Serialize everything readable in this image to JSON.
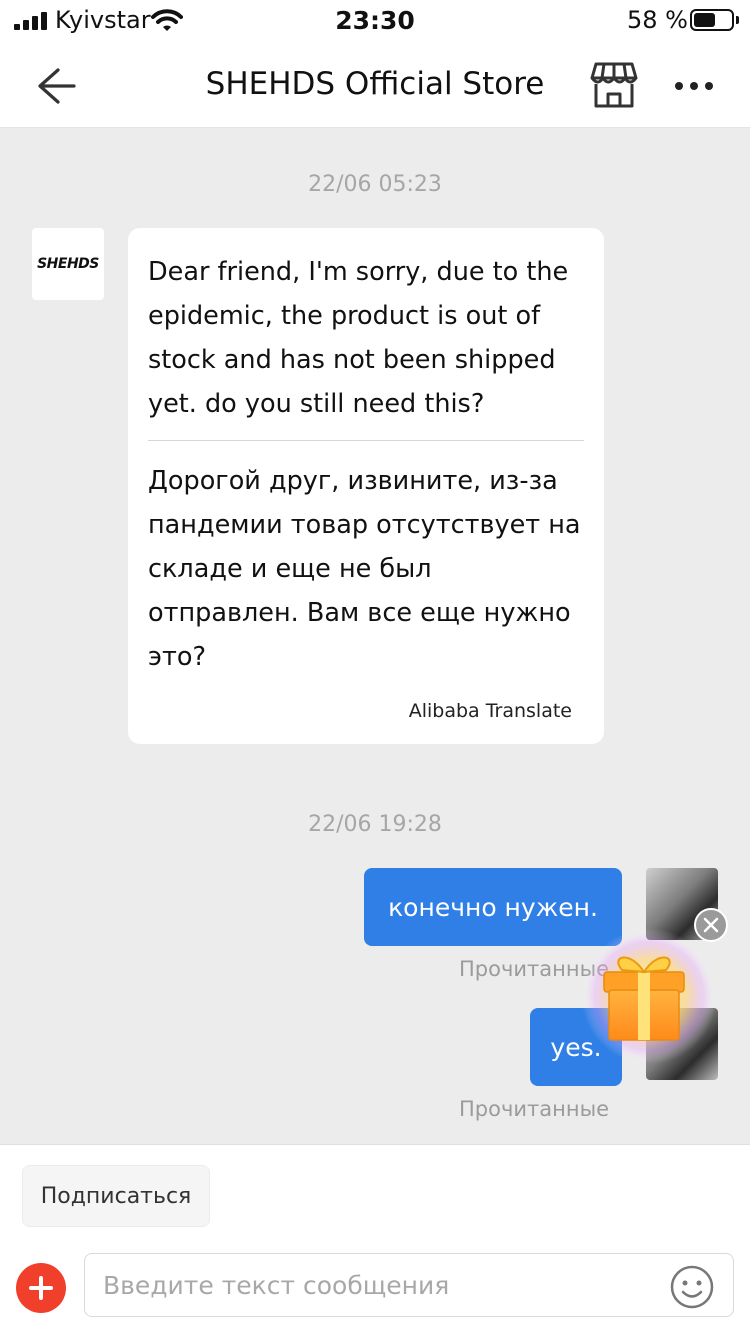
{
  "status_bar": {
    "carrier": "Kyivstar",
    "time": "23:30",
    "battery_percent": "58 %",
    "battery_level": 0.58,
    "icons": [
      "signal-icon",
      "wifi-icon",
      "battery-icon"
    ]
  },
  "header": {
    "title": "SHEHDS Official Store",
    "icons": [
      "back-arrow-icon",
      "store-icon",
      "more-icon"
    ]
  },
  "chat": {
    "timestamp_1": "22/06 05:23",
    "store_avatar_text": "SHEHDS",
    "store_message": {
      "original": "Dear friend, I'm sorry, due to the epidemic, the product is out of stock and has not been shipped yet. do you still need this?",
      "translation": "Дорогой друг, извините, из-за пандемии товар отсутствует на складе и еще не был отправлен. Вам все еще нужно это?",
      "credit": "Alibaba Translate"
    },
    "timestamp_2": "22/06 19:28",
    "user_messages": [
      {
        "text": "конечно нужен.",
        "status": "Прочитанные"
      },
      {
        "text": "yes.",
        "status": "Прочитанные"
      }
    ],
    "gift_icon": "gift-icon"
  },
  "bottom": {
    "subscribe_label": "Подписаться",
    "input_placeholder": "Введите текст сообщения",
    "icons": [
      "add-icon",
      "emoji-icon"
    ]
  },
  "colors": {
    "accent_blue": "#2f7fe6",
    "add_red": "#f0402c",
    "chat_bg": "#ececec"
  }
}
